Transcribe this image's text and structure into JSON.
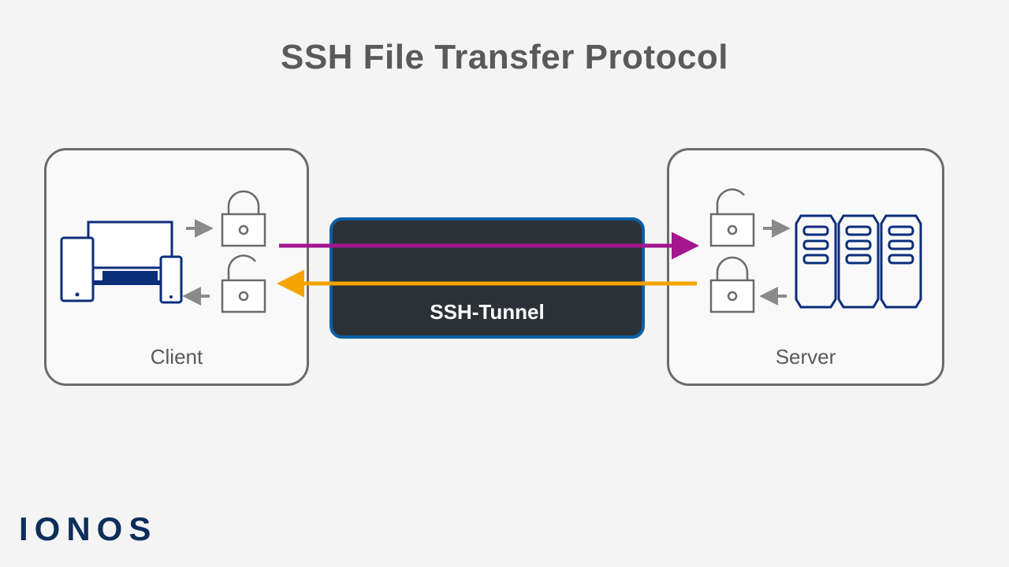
{
  "title": "SSH File Transfer Protocol",
  "client": {
    "label": "Client"
  },
  "server": {
    "label": "Server"
  },
  "tunnel": {
    "label": "SSH-Tunnel"
  },
  "brand": "IONOS",
  "colors": {
    "title": "#5a5a5a",
    "box_border": "#6b6b6b",
    "tunnel_bg": "#2b3136",
    "tunnel_border": "#0a5fa6",
    "arrow_request": "#a3168e",
    "arrow_response": "#f5a300",
    "device_outline": "#0b2e7a",
    "server_outline": "#0b2e7a",
    "lock_outline": "#6b6b6b",
    "grey_arrow": "#8a8a8a",
    "brand": "#0b2e5a"
  }
}
